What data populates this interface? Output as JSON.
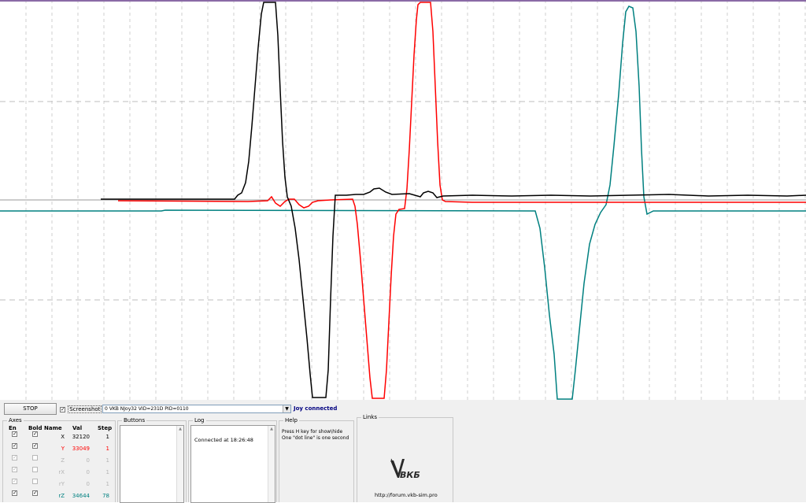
{
  "plot": {
    "background": "#ffffff",
    "grid_color": "#c0c0c0",
    "series": [
      {
        "name": "X",
        "color": "#000000"
      },
      {
        "name": "Y",
        "color": "#ff0000"
      },
      {
        "name": "rZ",
        "color": "#008080"
      }
    ]
  },
  "toolbar": {
    "stop_label": "STOP",
    "screenshot_label": "Screenshot",
    "screenshot_checked": "✓",
    "device_value": "0 VKB NJoy32  VID=231D PID=0110",
    "status_text": "Joy connected",
    "status_color": "#000080"
  },
  "axes": {
    "title": "Axes",
    "headers": {
      "en": "En",
      "bold": "Bold",
      "name": "Name",
      "val": "Val",
      "step": "Step"
    },
    "rows": [
      {
        "en": "✓",
        "bold": "✓",
        "name": "X",
        "val": "32120",
        "step": "1",
        "color": "#000000",
        "enabled": true
      },
      {
        "en": "✓",
        "bold": "✓",
        "name": "Y",
        "val": "33049",
        "step": "1",
        "color": "#ff0000",
        "enabled": true
      },
      {
        "en": "✓",
        "bold": "",
        "name": "Z",
        "val": "0",
        "step": "1",
        "color": "#b4b4b4",
        "enabled": false
      },
      {
        "en": "✓",
        "bold": "",
        "name": "rX",
        "val": "0",
        "step": "1",
        "color": "#b4b4b4",
        "enabled": false
      },
      {
        "en": "✓",
        "bold": "",
        "name": "rY",
        "val": "0",
        "step": "1",
        "color": "#b4b4b4",
        "enabled": false
      },
      {
        "en": "✓",
        "bold": "✓",
        "name": "rZ",
        "val": "34644",
        "step": "78",
        "color": "#008080",
        "enabled": true
      }
    ]
  },
  "buttons_group": {
    "title": "Buttons"
  },
  "log": {
    "title": "Log",
    "entries": [
      "Connected at 18:26:48"
    ]
  },
  "help": {
    "title": "Help",
    "line1": "Press H key for show\\hide",
    "line2": "One \"dot line\" is one second"
  },
  "links": {
    "title": "Links",
    "logo_text": "ВКБ",
    "url": "http://forum.vkb-sim.pro"
  }
}
